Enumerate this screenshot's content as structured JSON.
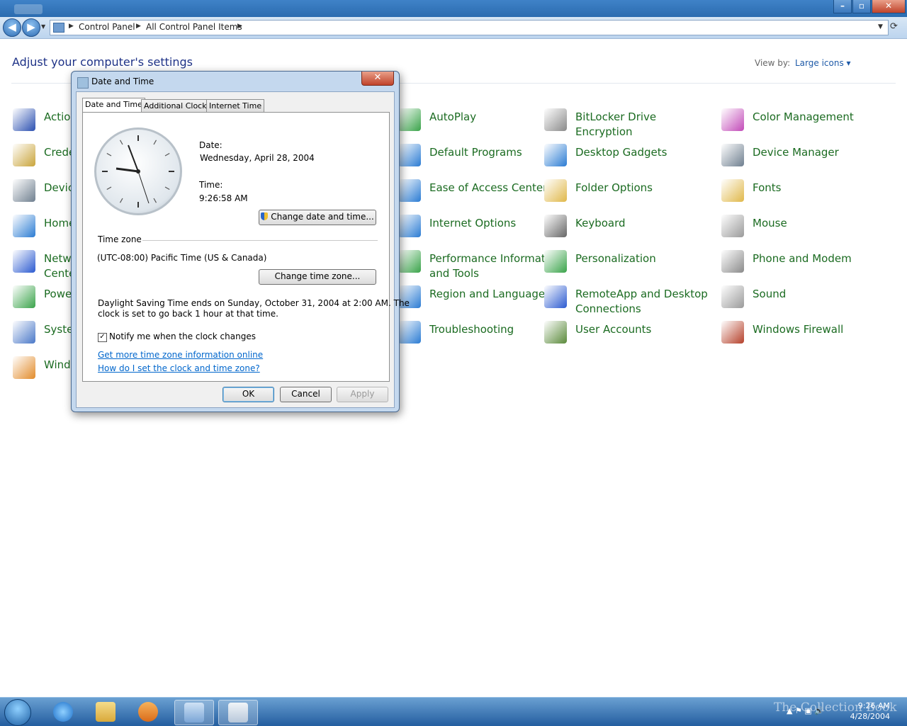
{
  "breadcrumb": [
    "Control Panel",
    "All Control Panel Items"
  ],
  "heading": "Adjust your computer's settings",
  "view_by": {
    "label": "View by:",
    "value": "Large icons"
  },
  "items": [
    {
      "label": "Action Center",
      "color": "#2a4fb0"
    },
    {
      "label": "Credential Manager",
      "color": "#c9a43a"
    },
    {
      "label": "Devices and Printers",
      "color": "#6f7f8f"
    },
    {
      "label": "HomeGroup",
      "color": "#2b7cd3"
    },
    {
      "label": "Network and Sharing Center",
      "color": "#2b5ad0"
    },
    {
      "label": "Power Options",
      "color": "#3aa34a"
    },
    {
      "label": "System",
      "color": "#4a78c8"
    },
    {
      "label": "Windows Update",
      "color": "#e28b2a"
    },
    {
      "label": "AutoPlay",
      "color": "#3aa34a"
    },
    {
      "label": "Default Programs",
      "color": "#2b7cd3"
    },
    {
      "label": "Ease of Access Center",
      "color": "#2b7cd3"
    },
    {
      "label": "Internet Options",
      "color": "#2b7cd3"
    },
    {
      "label": "Performance Information and Tools",
      "color": "#3aa34a"
    },
    {
      "label": "Region and Language",
      "color": "#2b7cd3"
    },
    {
      "label": "Troubleshooting",
      "color": "#2b7cd3"
    },
    {
      "label": "BitLocker Drive Encryption",
      "color": "#8a8a8a"
    },
    {
      "label": "Desktop Gadgets",
      "color": "#2b7cd3"
    },
    {
      "label": "Folder Options",
      "color": "#e0b84a"
    },
    {
      "label": "Keyboard",
      "color": "#666666"
    },
    {
      "label": "Personalization",
      "color": "#3aa34a"
    },
    {
      "label": "RemoteApp and Desktop Connections",
      "color": "#2b5ad0"
    },
    {
      "label": "User Accounts",
      "color": "#5a8a3a"
    },
    {
      "label": "Color Management",
      "color": "#c24ab8"
    },
    {
      "label": "Device Manager",
      "color": "#6f7f8f"
    },
    {
      "label": "Fonts",
      "color": "#e0b84a"
    },
    {
      "label": "Mouse",
      "color": "#9a9a9a"
    },
    {
      "label": "Phone and Modem",
      "color": "#8a8a8a"
    },
    {
      "label": "Sound",
      "color": "#9a9a9a"
    },
    {
      "label": "Windows Firewall",
      "color": "#b5402a"
    }
  ],
  "dialog": {
    "title": "Date and Time",
    "tabs": [
      "Date and Time",
      "Additional Clocks",
      "Internet Time"
    ],
    "date_label": "Date:",
    "date_value": "Wednesday, April 28, 2004",
    "time_label": "Time:",
    "time_value": "9:26:58 AM",
    "change_datetime_btn": "Change date and time...",
    "timezone_label": "Time zone",
    "timezone_value": "(UTC-08:00) Pacific Time (US & Canada)",
    "change_timezone_btn": "Change time zone...",
    "dst_line1": "Daylight Saving Time ends on Sunday, October 31, 2004 at 2:00 AM. The",
    "dst_line2": "clock is set to go back 1 hour at that time.",
    "notify_label": "Notify me when the clock changes",
    "notify_checked": true,
    "link1": "Get more time zone information online",
    "link2": "How do I set the clock and time zone?",
    "ok": "OK",
    "cancel": "Cancel",
    "apply": "Apply"
  },
  "taskbar": {
    "time": "9:26 AM",
    "date": "4/28/2004",
    "watermark": "The Collection Book"
  }
}
